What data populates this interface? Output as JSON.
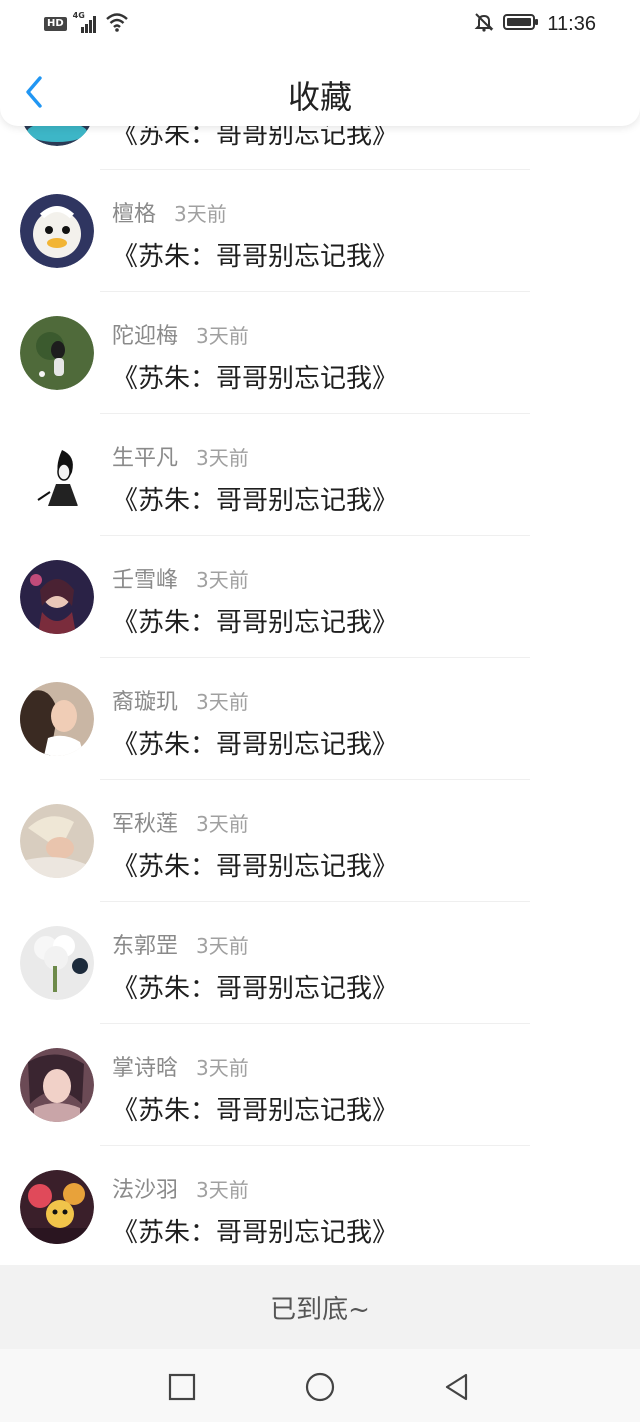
{
  "status_bar": {
    "hd_label": "HD",
    "network_label": "4G",
    "time": "11:36",
    "icons": [
      "signal-icon",
      "wifi-icon",
      "bell-muted-icon",
      "battery-icon"
    ]
  },
  "header": {
    "title": "收藏",
    "back_icon": "chevron-left-icon",
    "accent_color": "#2196f3"
  },
  "favorites": [
    {
      "name": "",
      "time": "",
      "title": "《苏朱：哥哥别忘记我》",
      "partial": true
    },
    {
      "name": "檀格",
      "time": "3天前",
      "title": "《苏朱：哥哥别忘记我》"
    },
    {
      "name": "陀迎梅",
      "time": "3天前",
      "title": "《苏朱：哥哥别忘记我》"
    },
    {
      "name": "生平凡",
      "time": "3天前",
      "title": "《苏朱：哥哥别忘记我》"
    },
    {
      "name": "壬雪峰",
      "time": "3天前",
      "title": "《苏朱：哥哥别忘记我》"
    },
    {
      "name": "裔璇玑",
      "time": "3天前",
      "title": "《苏朱：哥哥别忘记我》"
    },
    {
      "name": "军秋莲",
      "time": "3天前",
      "title": "《苏朱：哥哥别忘记我》"
    },
    {
      "name": "东郭罡",
      "time": "3天前",
      "title": "《苏朱：哥哥别忘记我》"
    },
    {
      "name": "掌诗晗",
      "time": "3天前",
      "title": "《苏朱：哥哥别忘记我》"
    },
    {
      "name": "法沙羽",
      "time": "3天前",
      "title": "《苏朱：哥哥别忘记我》"
    }
  ],
  "footer": {
    "end_text": "已到底~"
  },
  "nav_bar": {
    "icons": [
      "square-icon",
      "circle-icon",
      "triangle-back-icon"
    ]
  }
}
